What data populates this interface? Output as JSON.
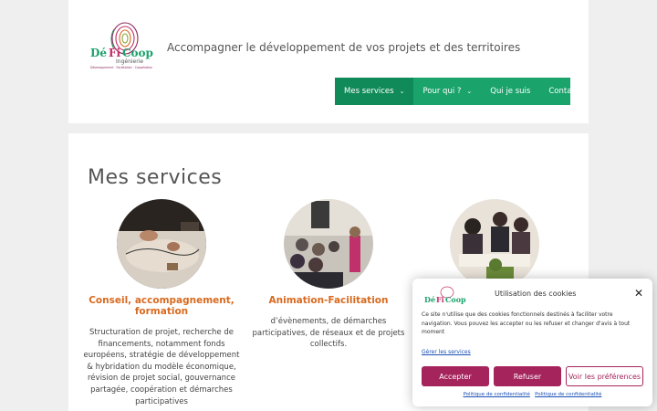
{
  "header": {
    "logo": {
      "main": "Dé Fi Coop",
      "sub": "Ingénierie",
      "tagline": "Développement · Facilitation · Coopération"
    },
    "tagline": "Accompagner le développement de vos projets et des territoires"
  },
  "nav": {
    "items": [
      {
        "label": "Mes services",
        "has_dropdown": true
      },
      {
        "label": "Pour qui ?",
        "has_dropdown": true
      },
      {
        "label": "Qui je suis",
        "has_dropdown": false
      },
      {
        "label": "Contact",
        "has_dropdown": false
      }
    ],
    "chevron": "⌄"
  },
  "main": {
    "title": "Mes services",
    "services": [
      {
        "title": "Conseil, accompagnement, formation",
        "description": "Structuration de projet, recherche de financements, notamment fonds européens, stratégie de développement & hybridation du modèle économique, révision de projet social, gouvernance partagée, coopération et démarches participatives"
      },
      {
        "title": "Animation-Facilitation",
        "description": "d’évènements, de démarches participatives, de réseaux et de projets collectifs."
      },
      {
        "title": "",
        "description": ""
      }
    ]
  },
  "cookie": {
    "title": "Utilisation des cookies",
    "close": "✕",
    "text": "Ce site n'utilise que des cookies fonctionnels destinés à faciliter votre navigation. Vous pouvez les accepter ou les refuser et changer d'avis à tout moment",
    "manage": "Gérer les services",
    "accept": "Accepter",
    "refuse": "Refuser",
    "preferences": "Voir les préférences",
    "footer_link1": "Politique de confidentialité",
    "footer_link2": "Politique de confidentialité"
  },
  "colors": {
    "nav_green": "#1aa36b",
    "nav_active": "#118a59",
    "service_title": "#d96a1f",
    "cookie_button": "#a5245c"
  }
}
